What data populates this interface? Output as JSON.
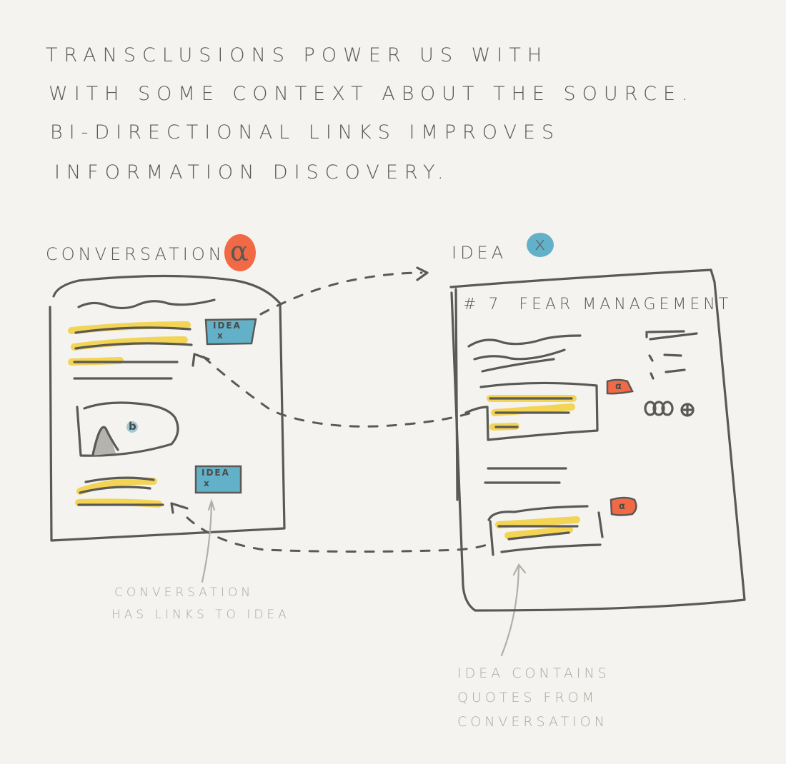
{
  "heading": {
    "lines": [
      "Transclusions power us with",
      "with some context about the source.",
      "Bi-directional links improves",
      "information discovery."
    ]
  },
  "conversation": {
    "label": "Conversation",
    "badge_symbol": "α",
    "idea_tag_top": "Idea",
    "idea_tag_top_symbol": "x",
    "idea_tag_bottom": "Idea",
    "idea_tag_bottom_symbol": "x",
    "chart_marker": "b"
  },
  "idea": {
    "label": "Idea",
    "badge_symbol": "x",
    "title": "# 7  Fear management",
    "quote_badge_1": "α",
    "quote_badge_2": "α",
    "reactions": "ooo ⊕"
  },
  "annotations": {
    "conversation_note": [
      "Conversation",
      "has links to idea"
    ],
    "idea_note": [
      "Idea contains",
      "quotes from",
      "conversation"
    ]
  },
  "colors": {
    "background": "#f4f3ef",
    "ink": "#5a5955",
    "highlight": "#f2d24c",
    "conversation_accent": "#f26a45",
    "idea_accent": "#63b1c8",
    "note_ink": "#a9a8a2"
  }
}
